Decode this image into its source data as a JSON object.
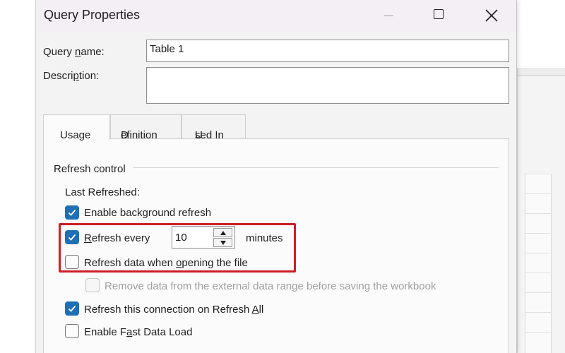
{
  "window": {
    "title": "Query Properties",
    "icons": {
      "minimize": "minimize-icon",
      "maximize": "maximize-icon",
      "close": "close-icon"
    }
  },
  "fields": {
    "query_name_label_pre": "Query ",
    "query_name_label_u": "n",
    "query_name_label_post": "ame:",
    "query_name_value": "Table 1",
    "description_label_pre": "Descri",
    "description_label_u": "p",
    "description_label_post": "tion:",
    "description_value": ""
  },
  "tabs": [
    {
      "pre": "",
      "u": "",
      "post": "Usage",
      "active": true
    },
    {
      "pre": "",
      "u": "D",
      "post": "efinition",
      "active": false
    },
    {
      "pre": "",
      "u": "U",
      "post": "sed In",
      "active": false
    }
  ],
  "usage": {
    "group_title": "Refresh control",
    "last_refreshed": "Last Refreshed:",
    "options": {
      "background": {
        "pre": "Enable background refresh",
        "u": "",
        "post": "",
        "checked": true
      },
      "refresh_every": {
        "pre": "",
        "u": "R",
        "post": "efresh every",
        "checked": true
      },
      "open_file": {
        "pre": "Refresh data when ",
        "u": "o",
        "post": "pening the file",
        "checked": false
      },
      "remove_data": {
        "label": "Remove data from the external data range before saving the workbook",
        "checked": false,
        "disabled": true
      },
      "refresh_all": {
        "pre": "Refresh this connection on Refresh ",
        "u": "A",
        "post": "ll",
        "checked": true
      },
      "fast_load": {
        "pre": "Enable F",
        "u": "a",
        "post": "st Data Load",
        "checked": false
      }
    },
    "interval_value": "10",
    "interval_unit": "minutes"
  },
  "colors": {
    "accent": "#1f6fb5",
    "highlight": "#cc1f25"
  }
}
